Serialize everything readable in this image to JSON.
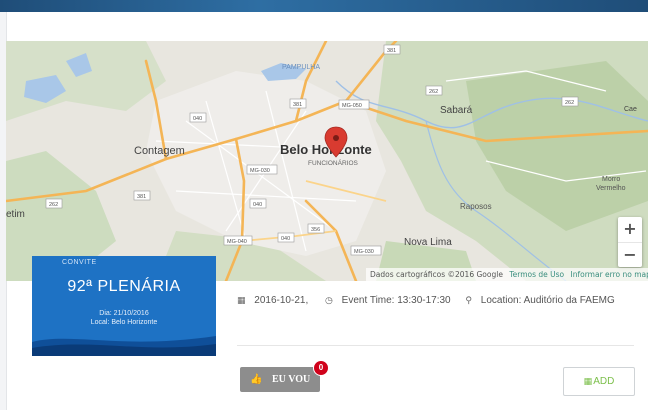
{
  "map": {
    "labels": {
      "pampulha": "PAMPULHA",
      "contagem": "Contagem",
      "belo_horizonte": "Belo Horizonte",
      "funcionarios": "FUNCIONÁRIOS",
      "sabara": "Sabará",
      "morro_vermelho_1": "Morro",
      "morro_vermelho_2": "Vermelho",
      "raposos": "Raposos",
      "nova_lima": "Nova Lima",
      "betim_partial": "etim",
      "cae_partial": "Cae"
    },
    "shields": {
      "s381_top": "381",
      "s381_left": "381",
      "s262_a": "262",
      "s262_b": "262",
      "s262_left": "262",
      "s040_a": "040",
      "s040_b": "040",
      "s040_c": "040",
      "s381_mid": "381",
      "mg050": "MG-050",
      "mg030": "MG-030",
      "mg040": "MG-040",
      "s356": "356",
      "mg030b": "MG-030"
    },
    "zoom_in": "+",
    "zoom_out": "−",
    "attribution": "Dados cartográficos ©2016 Google",
    "terms": "Termos de Uso",
    "report": "Informar erro no mapa"
  },
  "poster": {
    "tag": "CONVITE",
    "title": "92ª PLENÁRIA",
    "date_line": "Dia: 21/10/2016",
    "local_line": "Local: Belo Horizonte"
  },
  "event": {
    "date": "2016-10-21,",
    "time": "Event Time: 13:30-17:30",
    "location": "Location: Auditório da FAEMG"
  },
  "actions": {
    "eu_vou_label": "EU VOU",
    "eu_vou_count": "0",
    "add_label": "ADD"
  },
  "colors": {
    "poster_blue": "#1e72c4",
    "marker_red": "#d93b30",
    "add_green": "#7bbf4a",
    "badge_red": "#d0021b"
  },
  "icons": {
    "calendar": "calendar-icon",
    "clock": "clock-icon",
    "location": "map-marker-icon",
    "thumbs_up": "thumbs-up-icon"
  }
}
